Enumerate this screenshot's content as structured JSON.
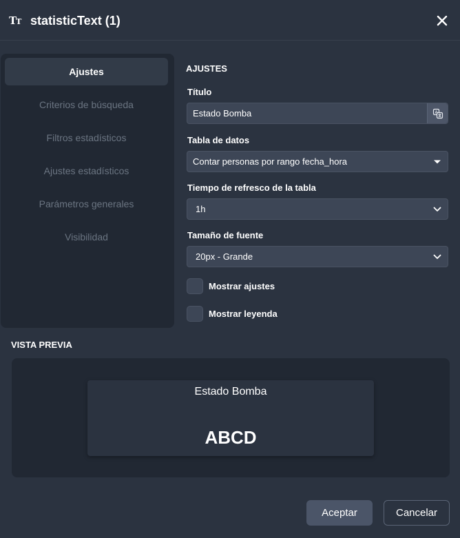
{
  "dialog": {
    "icon": "text-size-icon",
    "icon_glyph_big": "T",
    "icon_glyph_small": "T",
    "title": "statisticText (1)",
    "close_icon": "close-icon"
  },
  "sidebar": {
    "items": [
      {
        "label": "Ajustes",
        "active": true
      },
      {
        "label": "Criterios de búsqueda",
        "active": false
      },
      {
        "label": "Filtros estadísticos",
        "active": false
      },
      {
        "label": "Ajustes estadísticos",
        "active": false
      },
      {
        "label": "Parámetros generales",
        "active": false
      },
      {
        "label": "Visibilidad",
        "active": false
      }
    ]
  },
  "settings": {
    "section_title": "AJUSTES",
    "title_label": "Título",
    "title_value": "Estado Bomba",
    "translate_icon": "translate-icon",
    "table_label": "Tabla de datos",
    "table_value": "Contar personas por rango fecha_hora",
    "refresh_label": "Tiempo de refresco de la tabla",
    "refresh_value": "1h",
    "font_label": "Tamaño de fuente",
    "font_value": "20px - Grande",
    "show_settings_label": "Mostrar ajustes",
    "show_settings_checked": false,
    "show_legend_label": "Mostrar leyenda",
    "show_legend_checked": false
  },
  "preview": {
    "section_title": "VISTA PREVIA",
    "card_title": "Estado Bomba",
    "card_value": "ABCD"
  },
  "footer": {
    "accept_label": "Aceptar",
    "cancel_label": "Cancelar"
  },
  "colors": {
    "background": "#2b3340",
    "panel": "#212833",
    "field": "#3d4656",
    "accent_button": "#4b5568"
  }
}
